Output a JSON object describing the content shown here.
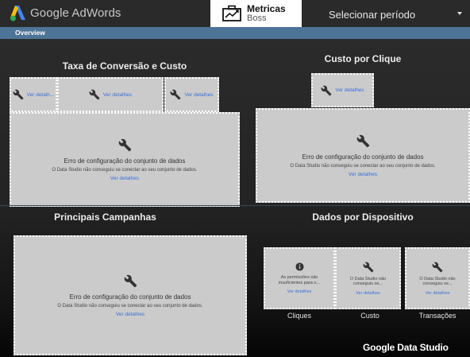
{
  "header": {
    "ads_title": "Google AdWords",
    "brand_name": "Metricas",
    "brand_sub": "Boss",
    "period_label": "Selecionar período"
  },
  "tabs": [
    "Overview"
  ],
  "sections": {
    "conversao": "Taxa de Conversão e Custo",
    "cpc": "Custo por Clique",
    "campanhas": "Principais Campanhas",
    "dispositivo": "Dados por Dispositivo"
  },
  "widget_error": {
    "title": "Erro de configuração do conjunto de dados",
    "message": "O Data Studio não conseguiu se conectar ao seu conjunto de dados.",
    "link": "Ver detalhes"
  },
  "small_links": {
    "truncated": "Ver detalh...",
    "full": "Ver detalhes"
  },
  "device_widgets": [
    {
      "message": "As permissões são insuficientes para o...",
      "link": "Ver detalhes",
      "icon": "info-icon"
    },
    {
      "message": "O Data Studio não conseguiu se...",
      "link": "Ver detalhes",
      "icon": "wrench-icon"
    },
    {
      "message": "O Data Studio não conseguiu se...",
      "link": "Ver detalhes",
      "icon": "wrench-icon"
    }
  ],
  "device_captions": [
    "Cliques",
    "Custo",
    "Transações"
  ],
  "footer": {
    "logo": "Google Data Studio"
  },
  "colors": {
    "tabbar": "#4e7497",
    "link": "#3a6fd8",
    "widget_bg": "#cbcbcb"
  }
}
